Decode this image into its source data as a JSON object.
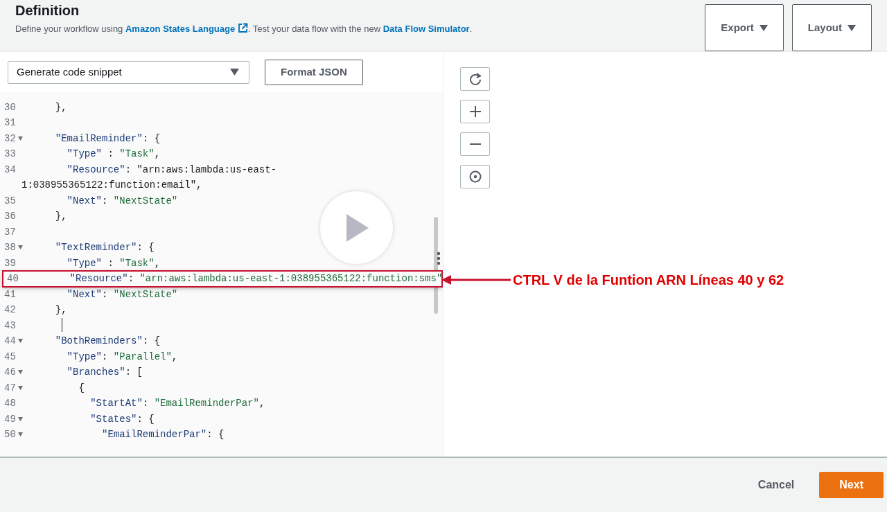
{
  "header": {
    "title": "Definition",
    "description": [
      {
        "kind": "text",
        "text": "Define your workflow using "
      },
      {
        "kind": "link",
        "text": "Amazon States Language",
        "external": true
      },
      {
        "kind": "text",
        "text": ". Test your data flow with the new "
      },
      {
        "kind": "link",
        "text": "Data Flow Simulator",
        "external": false
      },
      {
        "kind": "text",
        "text": "."
      }
    ],
    "buttons": [
      "Export",
      "Layout"
    ]
  },
  "editor": {
    "snippet_select": {
      "value": "Generate code snippet"
    },
    "format_button": "Format JSON",
    "lines": [
      {
        "number": "30",
        "fold": false,
        "text": "  },"
      },
      {
        "number": "31",
        "fold": false
      },
      {
        "number": "32",
        "fold": true,
        "text": "  \"EmailReminder\": {"
      },
      {
        "number": "33",
        "fold": false,
        "text": "    \"Type\" : \"Task\","
      },
      {
        "number": "34",
        "fold": false,
        "text": "    \"Resource\": \"arn:aws:lambda:us-east-",
        "continuation": "1:038955365122:function:email\","
      },
      {
        "number": "35",
        "fold": false,
        "text": "    \"Next\": \"NextState\""
      },
      {
        "number": "36",
        "fold": false,
        "text": "  },"
      },
      {
        "number": "37",
        "fold": false
      },
      {
        "number": "38",
        "fold": true,
        "text": "  \"TextReminder\": {"
      },
      {
        "number": "39",
        "fold": false,
        "text": "    \"Type\" : \"Task\","
      },
      {
        "number": "40",
        "fold": false,
        "text": "    \"Resource\": \"arn:aws:lambda:us-east-1:038955365122:function:sms\"",
        "highlighted": true
      },
      {
        "number": "41",
        "fold": false,
        "text": "    \"Next\": \"NextState\""
      },
      {
        "number": "42",
        "fold": false,
        "text": "  },"
      },
      {
        "number": "43",
        "fold": false,
        "cursor": true
      },
      {
        "number": "44",
        "fold": true,
        "text": "  \"BothReminders\": {"
      },
      {
        "number": "45",
        "fold": false,
        "text": "    \"Type\": \"Parallel\","
      },
      {
        "number": "46",
        "fold": true,
        "text": "    \"Branches\": ["
      },
      {
        "number": "47",
        "fold": true,
        "text": "      {"
      },
      {
        "number": "48",
        "fold": false,
        "text": "        \"StartAt\": \"EmailReminderPar\","
      },
      {
        "number": "49",
        "fold": true,
        "text": "        \"States\": {"
      },
      {
        "number": "50",
        "fold": true,
        "text": "          \"EmailReminderPar\": {"
      }
    ]
  },
  "annotation": {
    "text": "CTRL V de la Funtion ARN Líneas 40 y 62"
  },
  "graph_controls": [
    {
      "kind": "refresh"
    },
    {
      "kind": "zoom-in"
    },
    {
      "kind": "zoom-out"
    },
    {
      "kind": "center"
    }
  ],
  "footer": {
    "buttons": [
      {
        "label": "Cancel",
        "kind": "link"
      },
      {
        "label": "Next",
        "kind": "primary"
      }
    ]
  }
}
